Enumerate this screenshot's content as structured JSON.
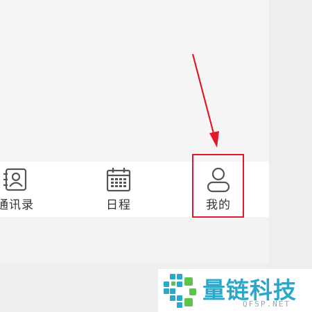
{
  "tabbar": {
    "tabs": [
      {
        "label": "通讯录",
        "icon": "contacts-icon"
      },
      {
        "label": "日程",
        "icon": "calendar-icon"
      },
      {
        "label": "我的",
        "icon": "user-profile-icon"
      }
    ]
  },
  "annotation": {
    "color": "#e0182a",
    "target": "tab-mine"
  },
  "watermark": {
    "brand": "量链科技",
    "domain": "QFSP.NET",
    "color": "#2aa8c9",
    "logo_icon": "puzzle-logo-icon"
  }
}
